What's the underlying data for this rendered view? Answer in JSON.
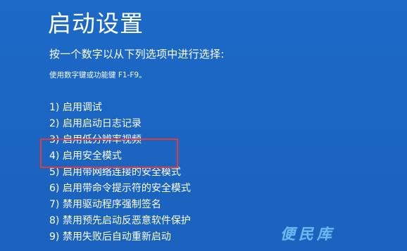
{
  "screen": {
    "title": "启动设置",
    "prompt": "按一个数字以从下列选项中进行选择:",
    "hint": "使用数字键或功能键 F1-F9。",
    "options": [
      "1) 启用调试",
      "2) 启用启动日志记录",
      "3) 启用低分辨率视频",
      "4) 启用安全模式",
      "5) 启用带网络连接的安全模式",
      "6) 启用带命令提示符的安全模式",
      "7) 禁用驱动程序强制签名",
      "8) 禁用预先启动反恶意软件保护",
      "9) 禁用失败后自动重新启动"
    ],
    "highlighted_option_index": 3,
    "watermark": "便民库"
  },
  "colors": {
    "background": "#1b67c4",
    "text": "#ffffff",
    "highlight_border": "#e23b3b",
    "watermark": "#67b7f2"
  }
}
